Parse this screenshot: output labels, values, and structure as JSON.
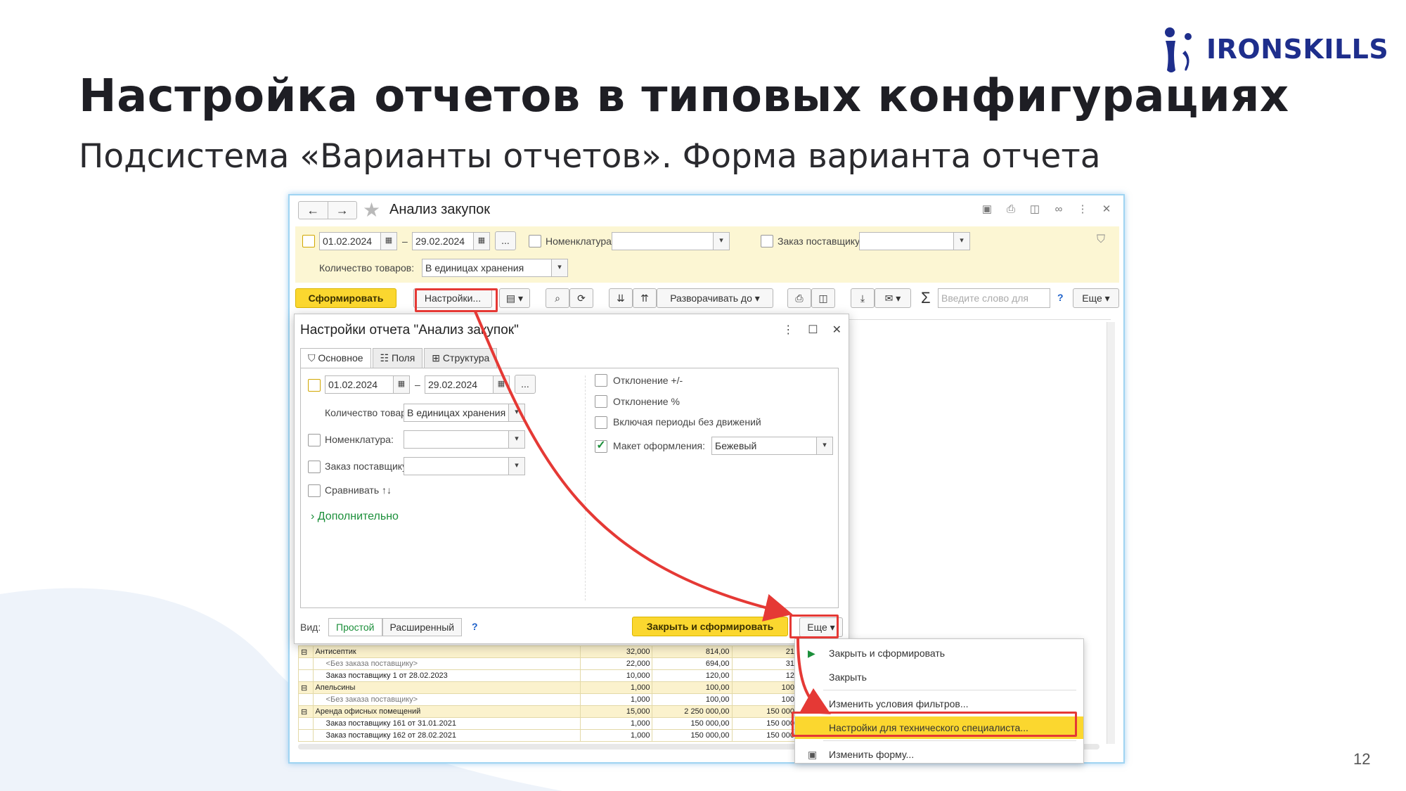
{
  "slide": {
    "title": "Настройка отчетов в типовых конфигурациях",
    "subtitle": "Подсистема «Варианты отчетов». Форма варианта отчета",
    "logo_text": "IRONSKILLS",
    "page_number": "12",
    "brand_color": "#1e2e8c"
  },
  "window": {
    "title": "Анализ закупок",
    "date_from": "01.02.2024",
    "date_sep": "–",
    "date_to": "29.02.2024",
    "ellipsis": "...",
    "nomenclature_label": "Номенклатура:",
    "supplier_order_label": "Заказ поставщику:",
    "qty_label": "Количество товаров:",
    "qty_value": "В единицах хранения",
    "toolbar": {
      "generate": "Сформировать",
      "settings": "Настройки...",
      "expand_to": "Разворачивать до",
      "search_placeholder": "Введите слово для",
      "help": "?",
      "more": "Еще"
    }
  },
  "dialog": {
    "title": "Настройки отчета \"Анализ закупок\"",
    "tabs": [
      "Основное",
      "Поля",
      "Структура"
    ],
    "date_from": "01.02.2024",
    "date_sep": "–",
    "date_to": "29.02.2024",
    "ellipsis": "...",
    "qty_label": "Количество товаров:",
    "qty_value": "В единицах хранения",
    "nomenclature_label": "Номенклатура:",
    "supplier_order_label": "Заказ поставщику:",
    "compare_label": "Сравнивать ↑↓",
    "more_link": "Дополнительно",
    "right_options": [
      "Отклонение +/-",
      "Отклонение %",
      "Включая периоды без движений"
    ],
    "layout_label": "Макет оформления:",
    "layout_value": "Бежевый",
    "view_label": "Вид:",
    "view_simple": "Простой",
    "view_extended": "Расширенный",
    "help": "?",
    "close_and_generate": "Закрыть и сформировать",
    "more": "Еще"
  },
  "menu": {
    "items": [
      "Закрыть и сформировать",
      "Закрыть",
      "Изменить условия фильтров...",
      "Настройки для технического специалиста...",
      "Изменить форму..."
    ]
  },
  "table": {
    "rows": [
      {
        "group": true,
        "name": "Антисептик",
        "a": "32,000",
        "b": "814,00",
        "c": "21"
      },
      {
        "group": false,
        "muted": true,
        "name": "<Без заказа поставщику>",
        "a": "22,000",
        "b": "694,00",
        "c": "31"
      },
      {
        "group": false,
        "muted": false,
        "name": "Заказ поставщику 1 от 28.02.2023",
        "a": "10,000",
        "b": "120,00",
        "c": "12"
      },
      {
        "group": true,
        "name": "Апельсины",
        "a": "1,000",
        "b": "100,00",
        "c": "100"
      },
      {
        "group": false,
        "muted": true,
        "name": "<Без заказа поставщику>",
        "a": "1,000",
        "b": "100,00",
        "c": "100"
      },
      {
        "group": true,
        "name": "Аренда офисных помещений",
        "a": "15,000",
        "b": "2 250 000,00",
        "c": "150 000"
      },
      {
        "group": false,
        "muted": false,
        "name": "Заказ поставщику 161 от 31.01.2021",
        "a": "1,000",
        "b": "150 000,00",
        "c": "150 000"
      },
      {
        "group": false,
        "muted": false,
        "name": "Заказ поставщику 162 от 28.02.2021",
        "a": "1,000",
        "b": "150 000,00",
        "c": "150 000"
      }
    ]
  },
  "colors": {
    "highlight_red": "#e53935",
    "accent_yellow": "#fbd72f",
    "filter_bg": "#fcf6d3",
    "link_green": "#1b8f3a"
  }
}
